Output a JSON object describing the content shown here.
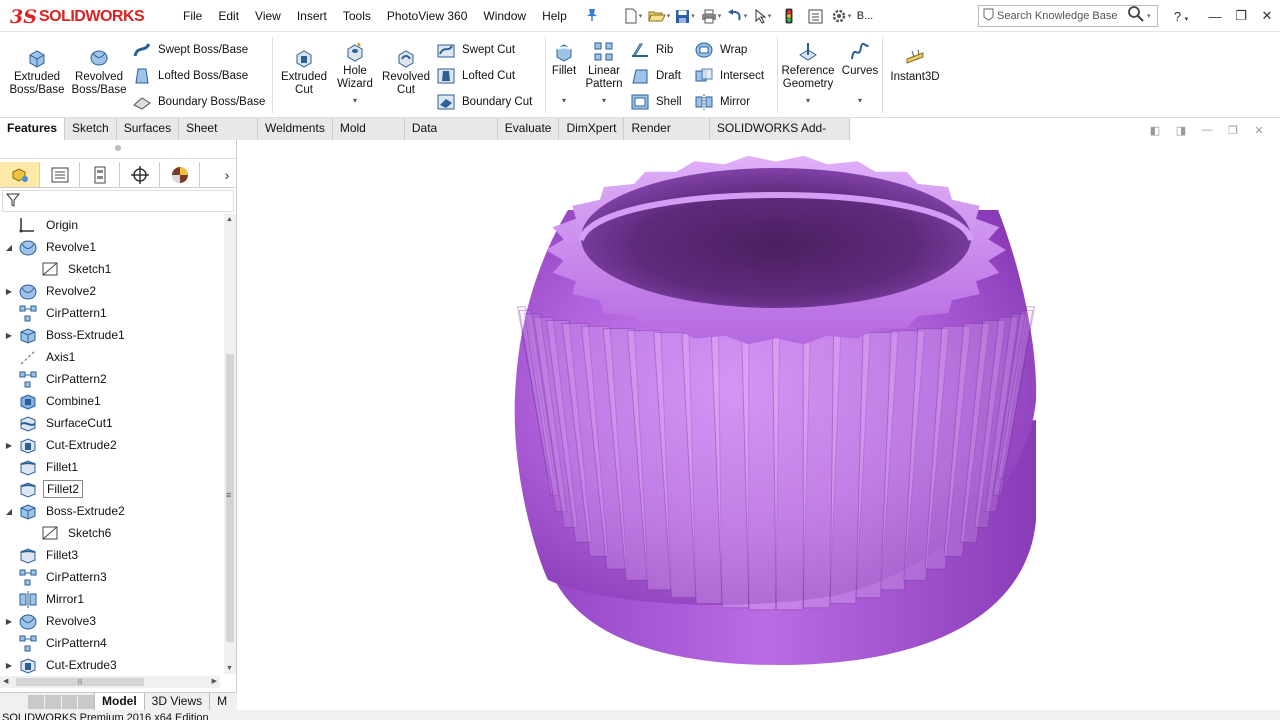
{
  "app": {
    "brand": "SOLIDWORKS",
    "brand_prefix": "3S",
    "status_text": "SOLIDWORKS Premium 2016 x64 Edition"
  },
  "menu": [
    "File",
    "Edit",
    "View",
    "Insert",
    "Tools",
    "PhotoView 360",
    "Window",
    "Help"
  ],
  "quick_access": {
    "more_label": "B..."
  },
  "search": {
    "placeholder": "Search Knowledge Base"
  },
  "ribbon": {
    "extruded_boss": [
      "Extruded",
      "Boss/Base"
    ],
    "revolved_boss": [
      "Revolved",
      "Boss/Base"
    ],
    "swept_boss": "Swept Boss/Base",
    "lofted_boss": "Lofted Boss/Base",
    "boundary_boss": "Boundary Boss/Base",
    "extruded_cut": [
      "Extruded",
      "Cut"
    ],
    "hole_wizard": [
      "Hole",
      "Wizard"
    ],
    "revolved_cut": [
      "Revolved",
      "Cut"
    ],
    "swept_cut": "Swept Cut",
    "lofted_cut": "Lofted Cut",
    "boundary_cut": "Boundary Cut",
    "fillet": "Fillet",
    "linear_pattern": [
      "Linear",
      "Pattern"
    ],
    "rib": "Rib",
    "draft": "Draft",
    "shell": "Shell",
    "wrap": "Wrap",
    "intersect": "Intersect",
    "mirror": "Mirror",
    "reference_geometry": [
      "Reference",
      "Geometry"
    ],
    "curves": "Curves",
    "instant3d": "Instant3D"
  },
  "tabs": [
    "Features",
    "Sketch",
    "Surfaces",
    "Sheet Metal",
    "Weldments",
    "Mold Tools",
    "Data Migration",
    "Evaluate",
    "DimXpert",
    "Render Tools",
    "SOLIDWORKS Add-Ins"
  ],
  "active_tab": "Features",
  "tree": [
    {
      "label": "Origin",
      "icon": "origin-icon",
      "expand": false,
      "child": false
    },
    {
      "label": "Revolve1",
      "icon": "revolve-icon",
      "expand": "open",
      "child": false
    },
    {
      "label": "Sketch1",
      "icon": "sketch-icon",
      "expand": false,
      "child": true
    },
    {
      "label": "Revolve2",
      "icon": "revolve-icon",
      "expand": "closed",
      "child": false
    },
    {
      "label": "CirPattern1",
      "icon": "cirpattern-icon",
      "expand": false,
      "child": false
    },
    {
      "label": "Boss-Extrude1",
      "icon": "extrude-icon",
      "expand": "closed",
      "child": false
    },
    {
      "label": "Axis1",
      "icon": "axis-icon",
      "expand": false,
      "child": false
    },
    {
      "label": "CirPattern2",
      "icon": "cirpattern-icon",
      "expand": false,
      "child": false
    },
    {
      "label": "Combine1",
      "icon": "combine-icon",
      "expand": false,
      "child": false
    },
    {
      "label": "SurfaceCut1",
      "icon": "surfacecut-icon",
      "expand": false,
      "child": false
    },
    {
      "label": "Cut-Extrude2",
      "icon": "cut-extrude-icon",
      "expand": "closed",
      "child": false
    },
    {
      "label": "Fillet1",
      "icon": "fillet-icon",
      "expand": false,
      "child": false
    },
    {
      "label": "Fillet2",
      "icon": "fillet-icon",
      "expand": false,
      "child": false,
      "selected": true
    },
    {
      "label": "Boss-Extrude2",
      "icon": "extrude-icon",
      "expand": "open",
      "child": false
    },
    {
      "label": "Sketch6",
      "icon": "sketch-icon",
      "expand": false,
      "child": true
    },
    {
      "label": "Fillet3",
      "icon": "fillet-icon",
      "expand": false,
      "child": false
    },
    {
      "label": "CirPattern3",
      "icon": "cirpattern-icon",
      "expand": false,
      "child": false
    },
    {
      "label": "Mirror1",
      "icon": "mirror-icon",
      "expand": false,
      "child": false
    },
    {
      "label": "Revolve3",
      "icon": "revolve-icon",
      "expand": "closed",
      "child": false
    },
    {
      "label": "CirPattern4",
      "icon": "cirpattern-icon",
      "expand": false,
      "child": false
    },
    {
      "label": "Cut-Extrude3",
      "icon": "cut-extrude-icon",
      "expand": "closed",
      "child": false
    }
  ],
  "bottom_tabs": [
    "Model",
    "3D Views",
    "M"
  ],
  "active_bottom_tab": "Model",
  "colors": {
    "brand_red": "#d22222",
    "model_purple": "#b060d8",
    "selection_tab": "#ffe9a8"
  }
}
